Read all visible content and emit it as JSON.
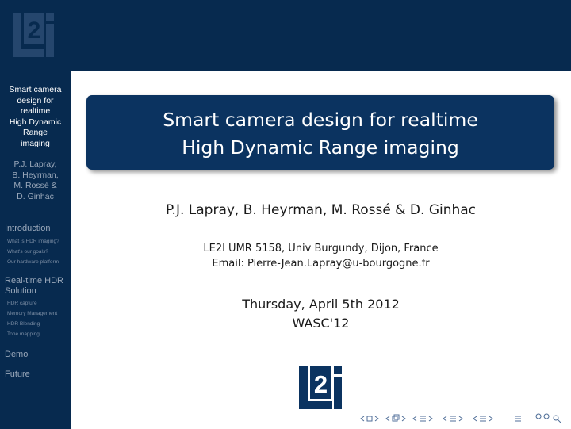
{
  "sidebar": {
    "title_lines": [
      "Smart camera",
      "design for",
      "realtime",
      "High Dynamic",
      "Range",
      "imaging"
    ],
    "author_lines": [
      "P.J. Lapray,",
      "B. Heyrman,",
      "M. Rossé &",
      "D. Ginhac"
    ],
    "sections": [
      {
        "label": "Introduction",
        "subs": [
          "What is HDR imaging?",
          "What's our goals?",
          "Our hardware platform"
        ]
      },
      {
        "label": "Real-time HDR Solution",
        "subs": [
          "HDR capture",
          "Memory Management",
          "HDR Blending",
          "Tone mapping"
        ]
      },
      {
        "label": "Demo",
        "subs": []
      },
      {
        "label": "Future",
        "subs": []
      }
    ]
  },
  "slide": {
    "title_line1": "Smart camera design for realtime",
    "title_line2": "High Dynamic Range imaging",
    "authors": "P.J. Lapray, B. Heyrman, M. Rossé & D. Ginhac",
    "affiliation": "LE2I UMR 5158, Univ Burgundy, Dijon, France",
    "email": "Email: Pierre-Jean.Lapray@u-bourgogne.fr",
    "date": "Thursday, April 5th 2012",
    "event": "WASC'12"
  },
  "logo": {
    "text": "L2i",
    "color": "#0b3360"
  },
  "colors": {
    "sidebar_bg": "#072a4f",
    "title_box": "#0b3360"
  }
}
